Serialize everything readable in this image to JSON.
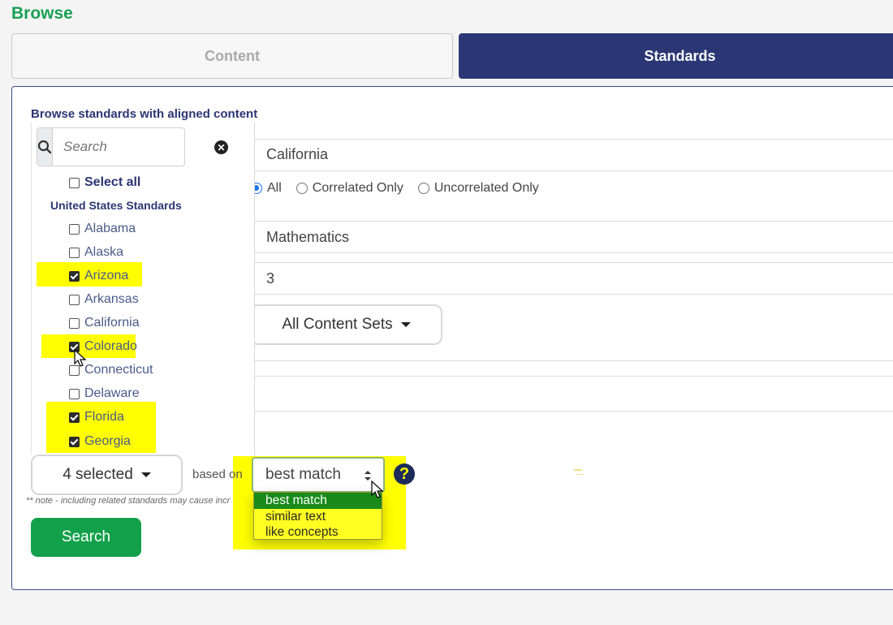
{
  "page": {
    "title": "Browse"
  },
  "tabs": [
    {
      "label": "Content",
      "active": false
    },
    {
      "label": "Standards",
      "active": true
    }
  ],
  "panel": {
    "heading": "Browse standards with aligned content"
  },
  "filters": {
    "jurisdiction": "California",
    "correlation": {
      "options": [
        "All",
        "Correlated Only",
        "Uncorrelated Only"
      ],
      "selected": "All"
    },
    "subject": "Mathematics",
    "grade": "3",
    "content_sets_label": "All Content Sets"
  },
  "state_picker": {
    "search_placeholder": "Search",
    "select_all_label": "Select all",
    "group_label": "United States Standards",
    "states": [
      {
        "name": "Alabama",
        "checked": false
      },
      {
        "name": "Alaska",
        "checked": false
      },
      {
        "name": "Arizona",
        "checked": true
      },
      {
        "name": "Arkansas",
        "checked": false
      },
      {
        "name": "California",
        "checked": false
      },
      {
        "name": "Colorado",
        "checked": true
      },
      {
        "name": "Connecticut",
        "checked": false
      },
      {
        "name": "Delaware",
        "checked": false
      },
      {
        "name": "Florida",
        "checked": true
      },
      {
        "name": "Georgia",
        "checked": true
      }
    ],
    "selected_summary": "4 selected"
  },
  "match": {
    "based_on_label": "based on",
    "selected": "best match",
    "options": [
      "best match",
      "similar text",
      "like concepts"
    ],
    "help_symbol": "?"
  },
  "note": "** note - including related standards may cause incr",
  "search_button": "Search",
  "icons": {
    "search": "search-icon",
    "clear": "clear-icon",
    "help": "help-icon",
    "caret": "caret-down-icon"
  },
  "colors": {
    "brand_green": "#1aa055",
    "navy": "#2b3674",
    "highlight": "#ffff00",
    "option_selected": "#1a8a1a"
  }
}
